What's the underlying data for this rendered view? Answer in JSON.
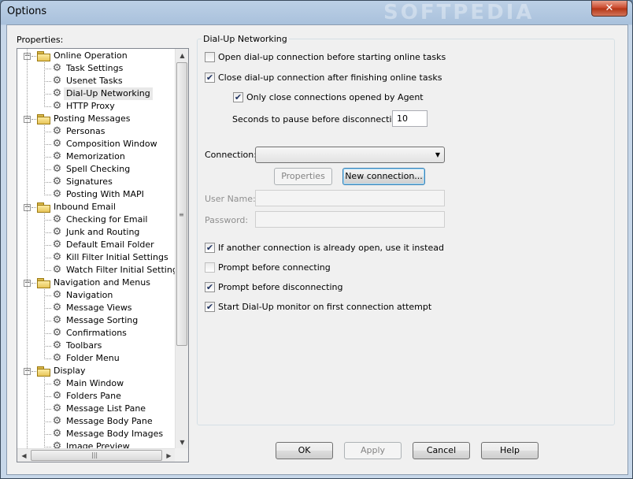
{
  "window": {
    "title": "Options",
    "watermark": "SOFTPEDIA",
    "close_glyph": "✕"
  },
  "left": {
    "properties_label": "Properties:",
    "tree": [
      {
        "label": "Online Operation",
        "level": 0,
        "expand": "−"
      },
      {
        "label": "Task Settings",
        "level": 1
      },
      {
        "label": "Usenet Tasks",
        "level": 1
      },
      {
        "label": "Dial-Up Networking",
        "level": 1,
        "selected": true
      },
      {
        "label": "HTTP Proxy",
        "level": 1
      },
      {
        "label": "Posting Messages",
        "level": 0,
        "expand": "−"
      },
      {
        "label": "Personas",
        "level": 1
      },
      {
        "label": "Composition Window",
        "level": 1
      },
      {
        "label": "Memorization",
        "level": 1
      },
      {
        "label": "Spell Checking",
        "level": 1
      },
      {
        "label": "Signatures",
        "level": 1
      },
      {
        "label": "Posting With MAPI",
        "level": 1
      },
      {
        "label": "Inbound Email",
        "level": 0,
        "expand": "−"
      },
      {
        "label": "Checking for Email",
        "level": 1
      },
      {
        "label": "Junk and Routing",
        "level": 1
      },
      {
        "label": "Default Email Folder",
        "level": 1
      },
      {
        "label": "Kill Filter Initial Settings",
        "level": 1
      },
      {
        "label": "Watch Filter Initial Settings",
        "level": 1
      },
      {
        "label": "Navigation and Menus",
        "level": 0,
        "expand": "−"
      },
      {
        "label": "Navigation",
        "level": 1
      },
      {
        "label": "Message Views",
        "level": 1
      },
      {
        "label": "Message Sorting",
        "level": 1
      },
      {
        "label": "Confirmations",
        "level": 1
      },
      {
        "label": "Toolbars",
        "level": 1
      },
      {
        "label": "Folder Menu",
        "level": 1
      },
      {
        "label": "Display",
        "level": 0,
        "expand": "−"
      },
      {
        "label": "Main Window",
        "level": 1
      },
      {
        "label": "Folders Pane",
        "level": 1
      },
      {
        "label": "Message List Pane",
        "level": 1
      },
      {
        "label": "Message Body Pane",
        "level": 1
      },
      {
        "label": "Message Body Images",
        "level": 1
      },
      {
        "label": "Image Preview",
        "level": 1
      }
    ],
    "scroll": {
      "up": "▲",
      "down": "▼",
      "left": "◀",
      "right": "▶",
      "vgrip": "≡",
      "hgrip": "|||"
    }
  },
  "dialup": {
    "group_title": "Dial-Up Networking",
    "open_before": {
      "label": "Open dial-up connection before starting online tasks",
      "checked": false
    },
    "close_after": {
      "label": "Close dial-up connection after finishing online tasks",
      "checked": true
    },
    "only_agent": {
      "label": "Only close connections opened by Agent",
      "checked": true
    },
    "pause_label": "Seconds to pause before disconnecting:",
    "pause_value": "10",
    "connection_label": "Connection:",
    "connection_value": "",
    "properties_button": "Properties",
    "new_connection_button": "New connection...",
    "username_label": "User Name:",
    "password_label": "Password:",
    "use_existing": {
      "label": "If another connection is already open, use it instead",
      "checked": true
    },
    "prompt_connect": {
      "label": "Prompt before connecting",
      "checked": false
    },
    "prompt_disconnect": {
      "label": "Prompt before disconnecting",
      "checked": true
    },
    "start_monitor": {
      "label": "Start Dial-Up monitor on first connection attempt",
      "checked": true
    }
  },
  "footer": {
    "ok": "OK",
    "apply": "Apply",
    "cancel": "Cancel",
    "help": "Help"
  },
  "check_glyph": "✔"
}
